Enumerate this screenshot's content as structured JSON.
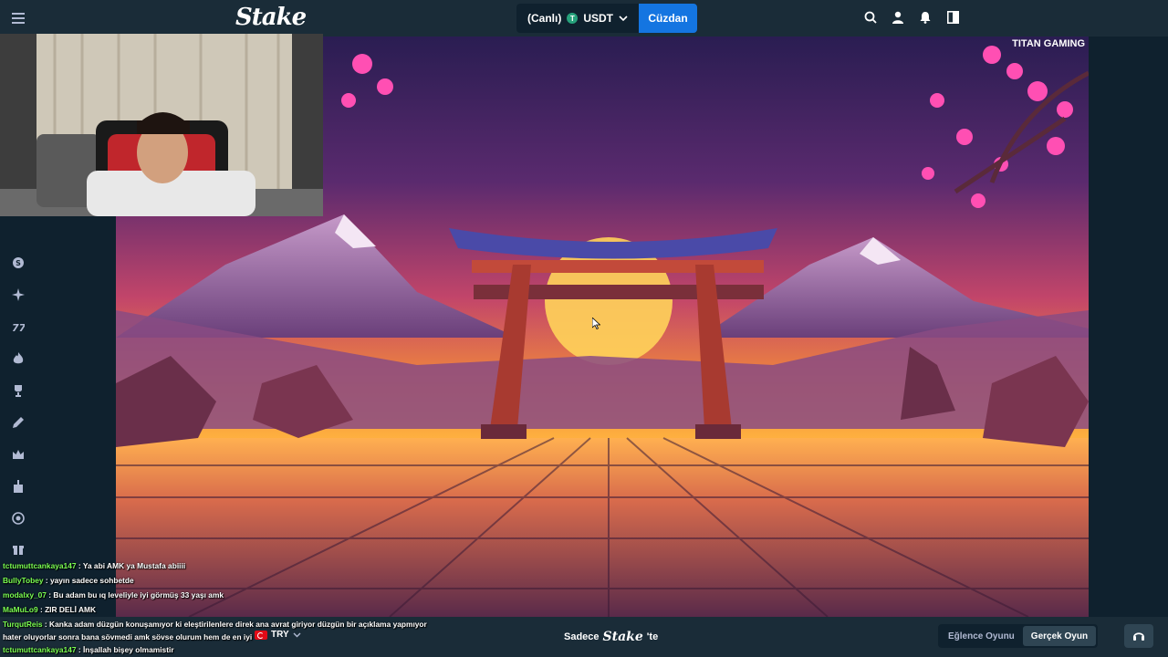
{
  "header": {
    "logo": "Stake",
    "currency_mode": "(Canlı)",
    "currency_code": "USDT",
    "currency_icon_letter": "T",
    "wallet_label": "Cüzdan"
  },
  "sidebar": {
    "icons": [
      "coin-icon",
      "sparkle-icon",
      "sevens-icon",
      "fire-icon",
      "trophy-icon",
      "pencil-icon",
      "crown-icon",
      "gift-icon",
      "target-icon",
      "gift-box-icon"
    ]
  },
  "game": {
    "provider_label": "TITAN GAMING"
  },
  "bottom": {
    "language": "TRY",
    "promo_prefix": "Sadece",
    "promo_logo": "Stake",
    "promo_suffix": "'te",
    "fun_mode": "Eğlence Oyunu",
    "real_mode": "Gerçek Oyun"
  },
  "chat": [
    {
      "user": "tctumuttcankaya147",
      "msg": ": Ya abi AMK ya Mustafa abiiii"
    },
    {
      "user": "BullyTobey",
      "msg": ": yayın sadece sohbetde"
    },
    {
      "user": "modalxy_07",
      "msg": ": Bu adam bu ıq leveliyle iyi görmüş 33 yaşı amk"
    },
    {
      "user": "MaMuLo9",
      "msg": ": ZIR DELİ AMK"
    },
    {
      "user": "TurqutReis",
      "msg": ": Kanka adam düzgün konuşamıyor ki eleştirilenlere direk ana avrat giriyor düzgün bir açıklama yapmıyor"
    },
    {
      "user": "",
      "msg": "hater oluyorlar sonra bana sövmedi amk sövse olurum hem de en iyi"
    },
    {
      "user": "tctumuttcankaya147",
      "msg": ": İnşallah bişey olmamistir"
    }
  ],
  "colors": {
    "topbar": "#1a2c38",
    "background": "#0f212e",
    "wallet_button": "#1475e1",
    "chat_username": "#7bff52"
  }
}
